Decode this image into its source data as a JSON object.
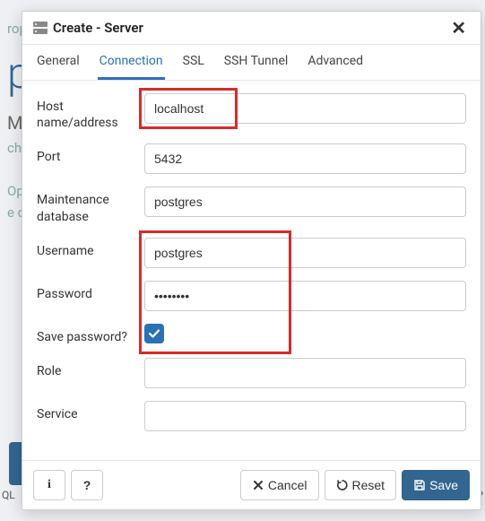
{
  "modal": {
    "title": "Create - Server",
    "tabs": {
      "general": "General",
      "connection": "Connection",
      "ssl": "SSL",
      "ssh": "SSH Tunnel",
      "advanced": "Advanced"
    },
    "active_tab": "connection"
  },
  "form": {
    "labels": {
      "host": "Host name/address",
      "port": "Port",
      "maintdb": "Maintenance database",
      "username": "Username",
      "password": "Password",
      "savepw": "Save password?",
      "role": "Role",
      "service": "Service"
    },
    "values": {
      "host": "localhost",
      "port": "5432",
      "maintdb": "postgres",
      "username": "postgres",
      "password": "••••••••",
      "savepw_checked": true,
      "role": "",
      "service": ""
    }
  },
  "footer": {
    "cancel": "Cancel",
    "reset": "Reset",
    "save": "Save"
  }
}
